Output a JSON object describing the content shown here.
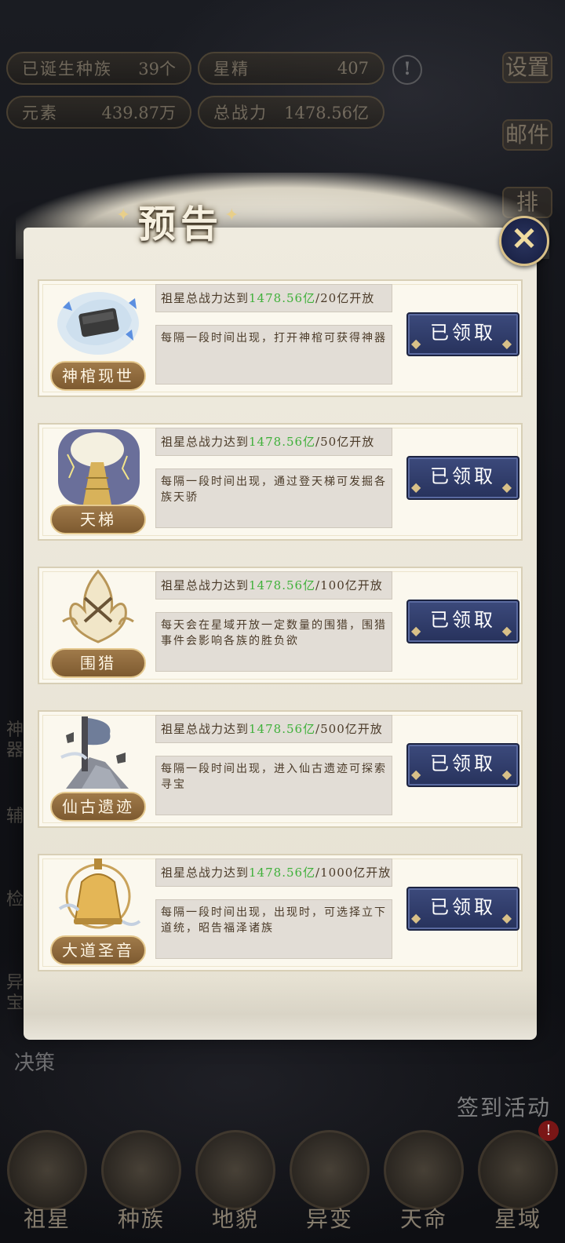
{
  "top": {
    "res1": {
      "label": "已诞生种族",
      "value": "39个"
    },
    "res2": {
      "label": "星精",
      "value": "407"
    },
    "res3": {
      "label": "元素",
      "value": "439.87万"
    },
    "res4": {
      "label": "总战力",
      "value": "1478.56亿"
    },
    "warn": "!"
  },
  "side": {
    "settings": "设置",
    "mail": "邮件",
    "rank": "排"
  },
  "left_dim": {
    "a": "神器",
    "b": "辅",
    "c": "检",
    "d": "异宝"
  },
  "jue": "决策",
  "qiandao": "签到活动",
  "bottom_nav": [
    "祖星",
    "种族",
    "地貌",
    "异变",
    "天命",
    "星域"
  ],
  "badge": "!",
  "dialog": {
    "title": "预告",
    "close": "✕",
    "items": [
      {
        "name": "神棺现世",
        "req_prefix": "祖星总战力达到",
        "current": "1478.56亿",
        "req_suffix": "/20亿开放",
        "desc": "每隔一段时间出现，打开神棺可获得神器",
        "button": "已领取",
        "icon": "coffin-icon"
      },
      {
        "name": "天梯",
        "req_prefix": "祖星总战力达到",
        "current": "1478.56亿",
        "req_suffix": "/50亿开放",
        "desc": "每隔一段时间出现，通过登天梯可发掘各族天骄",
        "button": "已领取",
        "icon": "ladder-icon"
      },
      {
        "name": "围猎",
        "req_prefix": "祖星总战力达到",
        "current": "1478.56亿",
        "req_suffix": "/100亿开放",
        "desc": "每天会在星域开放一定数量的围猎，围猎事件会影响各族的胜负欲",
        "button": "已领取",
        "icon": "hunt-icon"
      },
      {
        "name": "仙古遗迹",
        "req_prefix": "祖星总战力达到",
        "current": "1478.56亿",
        "req_suffix": "/500亿开放",
        "desc": "每隔一段时间出现，进入仙古遗迹可探索寻宝",
        "button": "已领取",
        "icon": "ruins-icon"
      },
      {
        "name": "大道圣音",
        "req_prefix": "祖星总战力达到",
        "current": "1478.56亿",
        "req_suffix": "/1000亿开放",
        "desc": "每隔一段时间出现，出现时，可选择立下道统，昭告福泽诸族",
        "button": "已领取",
        "icon": "bell-icon"
      }
    ]
  },
  "colors": {
    "accent_green": "#3fb03a",
    "button_blue": "#27325c",
    "gold": "#d8c088"
  }
}
